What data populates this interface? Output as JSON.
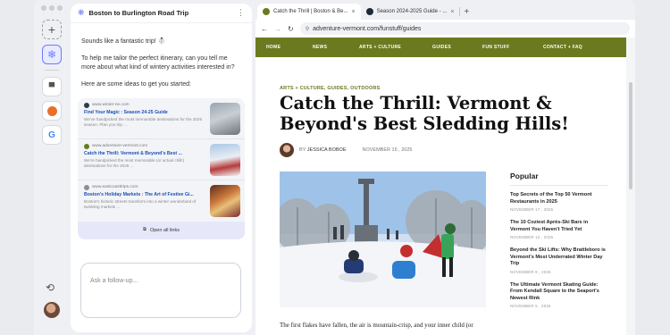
{
  "rail": {
    "new_icon": "plus-icon",
    "active_icon": "sparkle-icon",
    "apps": [
      "menu-app-icon",
      "basketball-app-icon",
      "google-app-icon"
    ],
    "google_glyph": "G",
    "history_icon": "history-icon"
  },
  "chat": {
    "title": "Boston to Burlington Road Trip",
    "messages": [
      "Sounds like a fantastic trip! ☃️",
      "To help me tailor the perfect itinerary, can you tell me more about what kind of wintery activities interested in?",
      "Here are some ideas to get you started:"
    ],
    "results": [
      {
        "site": "www.winter-ne.com",
        "title": "Find Your Magic : Season 24-25 Guide",
        "desc": "We've handpicked the most memorable destinations for the 2025 season. Plan you trip ..."
      },
      {
        "site": "www.adventure-vermont.com",
        "title": "Catch the Thrill: Vermont & Beyond's Best ...",
        "desc": "We're handpicked the most memorable (or actual chill!) destinations for the 2025 ..."
      },
      {
        "site": "www.eastcoasttrips.com",
        "title": "Boston's Holiday Markets : The Art of Festive Gi...",
        "desc": "Boston's historic streets transform into a winter wonderland of twinkling markets ..."
      }
    ],
    "open_all_label": "Open all links",
    "followup_placeholder": "Ask a follow-up..."
  },
  "browser": {
    "tabs": [
      {
        "title": "Catch the Thrill | Boston & Be...",
        "active": true
      },
      {
        "title": "Season 2024-2025 Guide - ...",
        "active": false
      }
    ],
    "new_tab": "+",
    "url": "adventure-vermont.com/funstuff/guides"
  },
  "site": {
    "menu": [
      "HOME",
      "NEWS",
      "ARTS + CULTURE",
      "GUIDES",
      "FUN STUFF",
      "CONTACT + FAQ"
    ],
    "accent": "#6b7a1e",
    "breadcrumb": "ARTS + CULTURE, GUIDES, OUTDOORS",
    "headline": "Catch the Thrill: Vermont & Beyond's Best Sledding Hills!",
    "author_prefix": "BY",
    "author": "JESSICA BOBOE",
    "date": "NOVEMBER 15 , 2025",
    "body_start": "The first flakes have fallen, the air is mountain-crisp, and your inner child (or",
    "popular_heading": "Popular",
    "popular": [
      {
        "title": "Top Secrets of the Top 50 Vermont Restaurants in 2025",
        "date": "NOVEMBER 17 , 2025"
      },
      {
        "title": "The 10 Coziest Après-Ski Bars in Vermont You Haven't Tried Yet",
        "date": "NOVEMBER 12 , 2025"
      },
      {
        "title": "Beyond the Ski Lifts: Why Brattleboro is Vermont's Most Underrated Winter Day Trip",
        "date": "NOVEMBER 9 , 2025"
      },
      {
        "title": "The Ultimate Vermont Skating Guide: From Kendall Square to the Seaport's Newest Rink",
        "date": "NOVEMBER 5 , 2025"
      }
    ]
  }
}
